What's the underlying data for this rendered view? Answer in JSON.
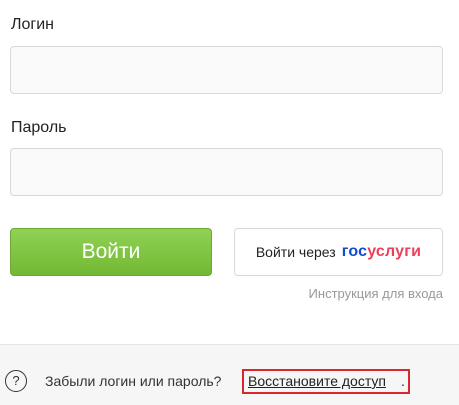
{
  "form": {
    "login_label": "Логин",
    "login_value": "",
    "password_label": "Пароль",
    "password_value": ""
  },
  "actions": {
    "login_button": "Войти",
    "gosuslugi_prefix": "Войти через",
    "gosuslugi_logo_part1": "гос",
    "gosuslugi_logo_part2": "услуги",
    "instruction_link": "Инструкция для входа"
  },
  "footer": {
    "help_icon": "?",
    "forgot_text": "Забыли логин или пароль?",
    "restore_link": "Восстановите доступ",
    "trailing_dot": "."
  },
  "colors": {
    "login_button": "#7bc142",
    "gosuslugi_blue": "#0d4cd3",
    "gosuslugi_red": "#ee3f58",
    "highlight_box": "#d9272e"
  }
}
